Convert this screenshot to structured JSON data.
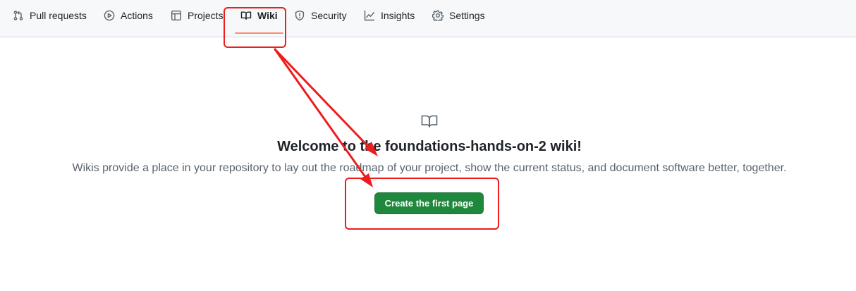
{
  "repo_nav": {
    "items": [
      {
        "label": "Pull requests",
        "icon": "git-pull-request-icon",
        "selected": false
      },
      {
        "label": "Actions",
        "icon": "play-circle-icon",
        "selected": false
      },
      {
        "label": "Projects",
        "icon": "table-icon",
        "selected": false
      },
      {
        "label": "Wiki",
        "icon": "book-icon",
        "selected": true
      },
      {
        "label": "Security",
        "icon": "shield-icon",
        "selected": false
      },
      {
        "label": "Insights",
        "icon": "graph-icon",
        "selected": false
      },
      {
        "label": "Settings",
        "icon": "gear-icon",
        "selected": false
      }
    ]
  },
  "wiki_blankslate": {
    "icon": "book-icon",
    "title": "Welcome to the foundations-hands-on-2 wiki!",
    "description": "Wikis provide a place in your repository to lay out the roadmap of your project, show the current status, and document software better, together.",
    "button_label": "Create the first page"
  },
  "colors": {
    "nav_background": "#f6f8fa",
    "selected_underline": "#fd8c73",
    "primary_button": "#1f883d",
    "annotation_red": "#ee1c1c"
  }
}
